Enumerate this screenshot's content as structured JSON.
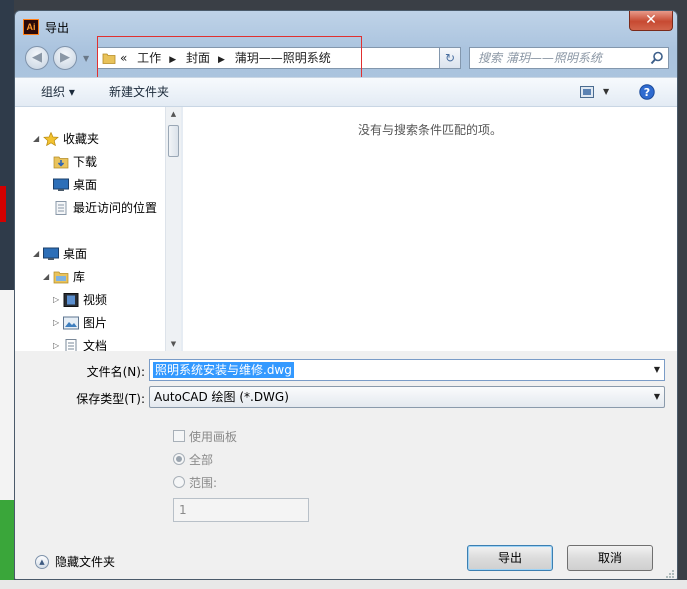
{
  "window": {
    "title": "导出",
    "app_icon": "Ai",
    "close_icon": "✕"
  },
  "nav": {
    "back_icon": "back-arrow-icon",
    "forward_icon": "forward-arrow-icon",
    "breadcrumb_prefix": "«",
    "breadcrumbs": [
      "工作",
      "封面",
      "蒲玥——照明系统"
    ],
    "search_placeholder": "搜索 蒲玥——照明系统"
  },
  "toolbar": {
    "organize": "组织 ▾",
    "new_folder": "新建文件夹"
  },
  "tree": {
    "favorites": "收藏夹",
    "downloads": "下载",
    "desktop_fav": "桌面",
    "recent": "最近访问的位置",
    "desktop": "桌面",
    "library": "库",
    "videos": "视频",
    "pictures": "图片",
    "documents": "文档"
  },
  "files": {
    "empty_message": "没有与搜索条件匹配的项。"
  },
  "form": {
    "filename_label": "文件名(N):",
    "filename_value": "照明系统安装与维修.dwg",
    "type_label": "保存类型(T):",
    "type_value": "AutoCAD 绘图 (*.DWG)",
    "use_artboards": "使用画板",
    "all": "全部",
    "range": "范围:",
    "range_value": "1"
  },
  "footer": {
    "hide_folders": "隐藏文件夹",
    "export_button": "导出",
    "cancel_button": "取消"
  },
  "colors": {
    "accent": "#3399ff",
    "window_frame": "#b9cfe6",
    "highlight_box": "#e03030"
  }
}
